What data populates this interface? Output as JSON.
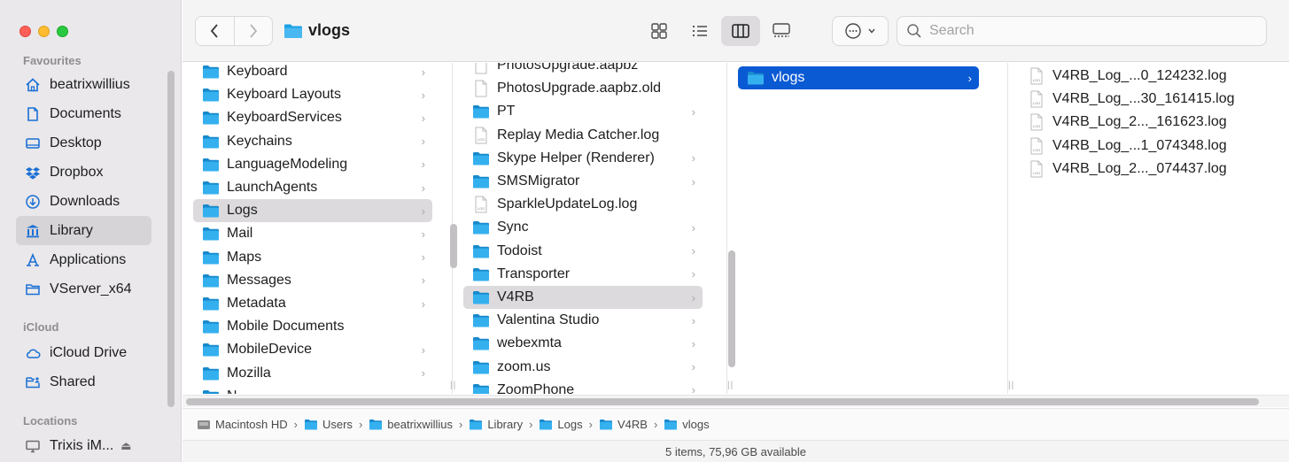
{
  "toolbar": {
    "title": "vlogs",
    "search_placeholder": "Search"
  },
  "sidebar": {
    "sections": [
      {
        "heading": "Favourites"
      },
      {
        "heading": "iCloud"
      },
      {
        "heading": "Locations"
      }
    ],
    "favourites": [
      {
        "label": "beatrixwillius",
        "icon": "home-icon"
      },
      {
        "label": "Documents",
        "icon": "document-icon"
      },
      {
        "label": "Desktop",
        "icon": "desktop-icon"
      },
      {
        "label": "Dropbox",
        "icon": "dropbox-icon"
      },
      {
        "label": "Downloads",
        "icon": "download-icon"
      },
      {
        "label": "Library",
        "icon": "library-icon",
        "selected": true
      },
      {
        "label": "Applications",
        "icon": "applications-icon"
      },
      {
        "label": "VServer_x64",
        "icon": "folder-icon"
      }
    ],
    "icloud": [
      {
        "label": "iCloud Drive",
        "icon": "cloud-icon"
      },
      {
        "label": "Shared",
        "icon": "shared-folder-icon"
      }
    ],
    "locations": [
      {
        "label": "Trixis iM...",
        "icon": "computer-icon"
      }
    ]
  },
  "columns": {
    "col1": [
      {
        "label": "Keyboard",
        "type": "folder",
        "chevron": true
      },
      {
        "label": "Keyboard Layouts",
        "type": "folder",
        "chevron": true
      },
      {
        "label": "KeyboardServices",
        "type": "folder",
        "chevron": true
      },
      {
        "label": "Keychains",
        "type": "folder",
        "chevron": true
      },
      {
        "label": "LanguageModeling",
        "type": "folder",
        "chevron": true
      },
      {
        "label": "LaunchAgents",
        "type": "folder",
        "chevron": true
      },
      {
        "label": "Logs",
        "type": "folder",
        "chevron": true,
        "state": "selected"
      },
      {
        "label": "Mail",
        "type": "folder",
        "chevron": true
      },
      {
        "label": "Maps",
        "type": "folder",
        "chevron": true
      },
      {
        "label": "Messages",
        "type": "folder",
        "chevron": true
      },
      {
        "label": "Metadata",
        "type": "folder",
        "chevron": true
      },
      {
        "label": "Mobile Documents",
        "type": "folder",
        "chevron": false
      },
      {
        "label": "MobileDevice",
        "type": "folder",
        "chevron": true
      },
      {
        "label": "Mozilla",
        "type": "folder",
        "chevron": true
      },
      {
        "label": "N...",
        "type": "folder",
        "chevron": false
      }
    ],
    "col2": [
      {
        "label": "PhotosUpgrade.aapbz",
        "type": "file",
        "chevron": false
      },
      {
        "label": "PhotosUpgrade.aapbz.old",
        "type": "file",
        "chevron": false
      },
      {
        "label": "PT",
        "type": "folder",
        "chevron": true
      },
      {
        "label": "Replay Media Catcher.log",
        "type": "log",
        "chevron": false
      },
      {
        "label": "Skype Helper (Renderer)",
        "type": "folder",
        "chevron": true
      },
      {
        "label": "SMSMigrator",
        "type": "folder",
        "chevron": true
      },
      {
        "label": "SparkleUpdateLog.log",
        "type": "log",
        "chevron": false
      },
      {
        "label": "Sync",
        "type": "folder",
        "chevron": true
      },
      {
        "label": "Todoist",
        "type": "folder",
        "chevron": true
      },
      {
        "label": "Transporter",
        "type": "folder",
        "chevron": true
      },
      {
        "label": "V4RB",
        "type": "folder",
        "chevron": true,
        "state": "selected"
      },
      {
        "label": "Valentina Studio",
        "type": "folder",
        "chevron": true
      },
      {
        "label": "webexmta",
        "type": "folder",
        "chevron": true
      },
      {
        "label": "zoom.us",
        "type": "folder",
        "chevron": true
      },
      {
        "label": "ZoomPhone",
        "type": "folder",
        "chevron": true
      }
    ],
    "col3": [
      {
        "label": "vlogs",
        "type": "folder",
        "chevron": true,
        "state": "active"
      }
    ],
    "col4": [
      {
        "label": "V4RB_Log_...0_124232.log",
        "type": "log"
      },
      {
        "label": "V4RB_Log_...30_161415.log",
        "type": "log"
      },
      {
        "label": "V4RB_Log_2..._161623.log",
        "type": "log"
      },
      {
        "label": "V4RB_Log_...1_074348.log",
        "type": "log"
      },
      {
        "label": "V4RB_Log_2..._074437.log",
        "type": "log"
      }
    ]
  },
  "pathbar": [
    {
      "label": "Macintosh HD",
      "icon": "disk-icon"
    },
    {
      "label": "Users",
      "icon": "folder-icon"
    },
    {
      "label": "beatrixwillius",
      "icon": "home-folder-icon"
    },
    {
      "label": "Library",
      "icon": "folder-icon"
    },
    {
      "label": "Logs",
      "icon": "folder-icon"
    },
    {
      "label": "V4RB",
      "icon": "folder-icon"
    },
    {
      "label": "vlogs",
      "icon": "folder-icon"
    }
  ],
  "status": "5 items, 75,96 GB available",
  "colors": {
    "accent": "#0a5ad4",
    "folder": "#1aa0e6",
    "sidebar_icon": "#1a6fd6"
  }
}
